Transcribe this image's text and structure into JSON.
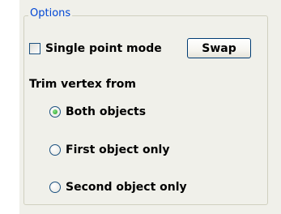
{
  "options": {
    "legend": "Options",
    "single_point_mode": {
      "label": "Single point mode",
      "checked": false
    },
    "swap_button": "Swap",
    "trim_label": "Trim vertex from",
    "trim_options": [
      {
        "label": "Both objects",
        "selected": true
      },
      {
        "label": "First object only",
        "selected": false
      },
      {
        "label": "Second object only",
        "selected": false
      }
    ]
  },
  "colors": {
    "legend_text": "#0046d5",
    "panel_background": "#f0f0ea",
    "groupbox_border": "#d0d0bf",
    "radio_dot": "#21a121"
  }
}
